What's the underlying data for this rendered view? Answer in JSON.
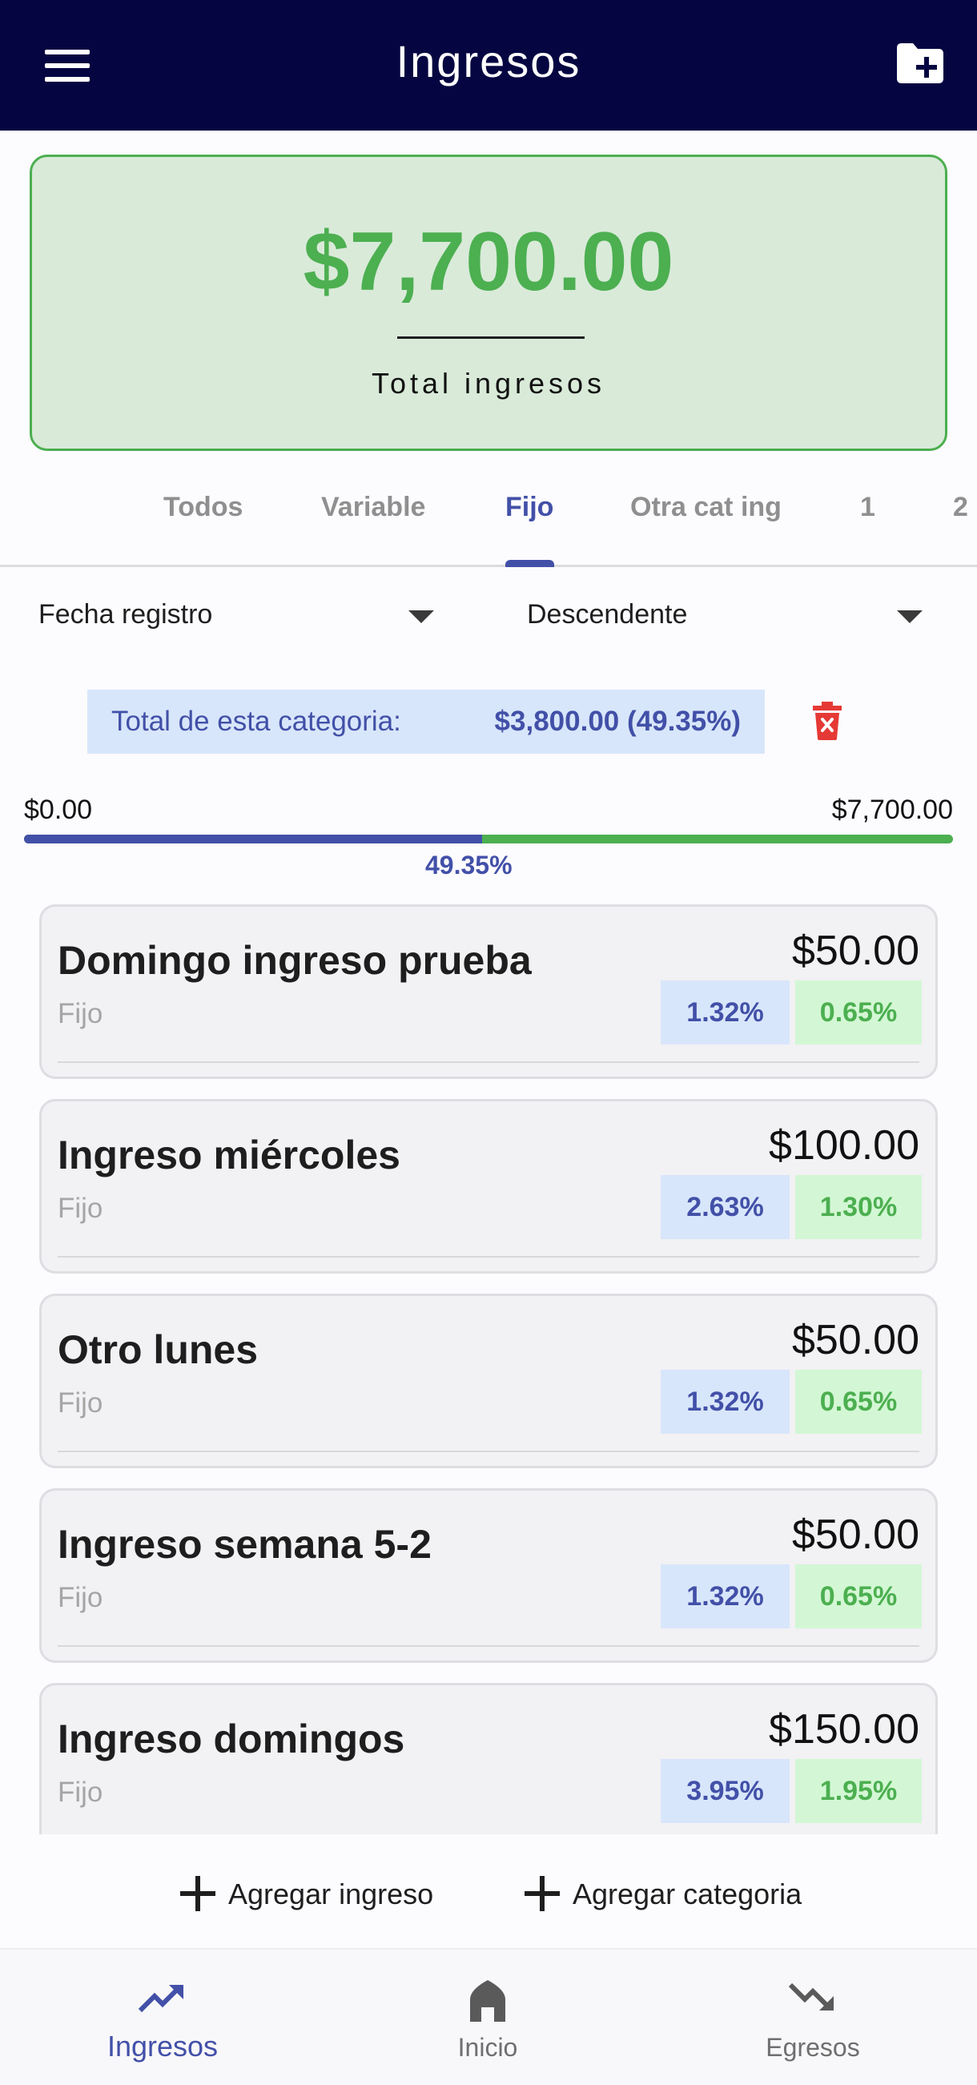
{
  "header": {
    "title": "Ingresos",
    "menu_icon": "menu-icon",
    "action_icon": "create-folder-icon"
  },
  "summary": {
    "amount": "$7,700.00",
    "label": "Total ingresos"
  },
  "tabs": [
    {
      "label": "Todos",
      "active": false
    },
    {
      "label": "Variable",
      "active": false
    },
    {
      "label": "Fijo",
      "active": true
    },
    {
      "label": "Otra cat ing",
      "active": false
    },
    {
      "label": "1",
      "active": false
    },
    {
      "label": "2",
      "active": false
    }
  ],
  "sort": {
    "field": "Fecha registro",
    "order": "Descendente"
  },
  "category_total": {
    "label": "Total de esta categoria:",
    "value": "$3,800.00 (49.35%)"
  },
  "progress": {
    "min": "$0.00",
    "max": "$7,700.00",
    "label": "49.35%",
    "fraction": 0.4935
  },
  "items": [
    {
      "name": "Domingo ingreso prueba",
      "category": "Fijo",
      "amount": "$50.00",
      "pct_category": "1.32%",
      "pct_total": "0.65%"
    },
    {
      "name": "Ingreso miércoles",
      "category": "Fijo",
      "amount": "$100.00",
      "pct_category": "2.63%",
      "pct_total": "1.30%"
    },
    {
      "name": "Otro lunes",
      "category": "Fijo",
      "amount": "$50.00",
      "pct_category": "1.32%",
      "pct_total": "0.65%"
    },
    {
      "name": "Ingreso semana 5-2",
      "category": "Fijo",
      "amount": "$50.00",
      "pct_category": "1.32%",
      "pct_total": "0.65%"
    },
    {
      "name": "Ingreso domingos",
      "category": "Fijo",
      "amount": "$150.00",
      "pct_category": "3.95%",
      "pct_total": "1.95%"
    }
  ],
  "actions": {
    "add_income": "Agregar ingreso",
    "add_category": "Agregar categoria"
  },
  "nav": [
    {
      "label": "Ingresos",
      "icon": "trending-up-icon",
      "active": true
    },
    {
      "label": "Inicio",
      "icon": "home-icon",
      "active": false
    },
    {
      "label": "Egresos",
      "icon": "trending-down-icon",
      "active": false
    }
  ],
  "colors": {
    "appbar": "#050641",
    "primary": "#4250a8",
    "income_green": "#4caf50",
    "delete_red": "#e53935"
  }
}
